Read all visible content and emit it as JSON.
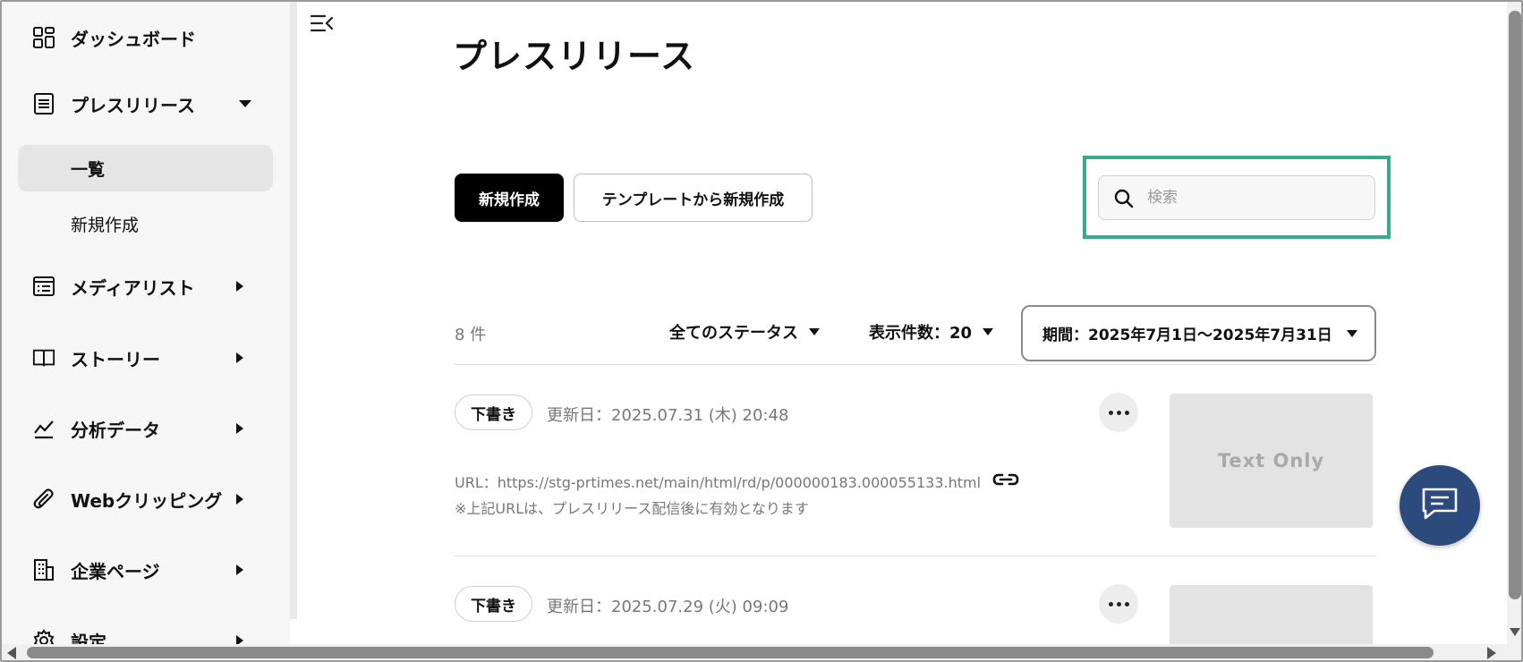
{
  "sidebar": {
    "items": [
      {
        "label": "ダッシュボード",
        "icon": "dashboard-icon"
      },
      {
        "label": "プレスリリース",
        "icon": "document-icon",
        "expanded": true
      },
      {
        "label": "メディアリスト",
        "icon": "list-icon"
      },
      {
        "label": "ストーリー",
        "icon": "book-icon"
      },
      {
        "label": "分析データ",
        "icon": "chart-icon"
      },
      {
        "label": "Webクリッピング",
        "icon": "paperclip-icon"
      },
      {
        "label": "企業ページ",
        "icon": "building-icon"
      },
      {
        "label": "設定",
        "icon": "gear-icon"
      }
    ],
    "sub_items": [
      {
        "label": "一覧",
        "active": true
      },
      {
        "label": "新規作成",
        "active": false
      }
    ]
  },
  "main": {
    "title": "プレスリリース",
    "new_button": "新規作成",
    "template_button": "テンプレートから新規作成",
    "search": {
      "placeholder": "検索",
      "value": ""
    },
    "count": "8 件",
    "status_filter": "全てのステータス",
    "per_page_filter": "表示件数：20",
    "period_filter": "期間：2025年7月1日～2025年7月31日",
    "releases": [
      {
        "status": "下書き",
        "updated": "更新日：2025.07.31 (木) 20:48",
        "url": "URL：https://stg-prtimes.net/main/html/rd/p/000000183.000055133.html",
        "note": "※上記URLは、プレスリリース配信後に有効となります",
        "thumbnail": "Text Only"
      },
      {
        "status": "下書き",
        "updated": "更新日：2025.07.29 (火) 09:09",
        "thumbnail": ""
      }
    ]
  },
  "colors": {
    "highlight": "#3aaa8c",
    "fab": "#2c4a7c",
    "primary_button": "#000000",
    "sidebar_bg": "#f6f6f6",
    "active_item_bg": "#e5e5e5"
  }
}
